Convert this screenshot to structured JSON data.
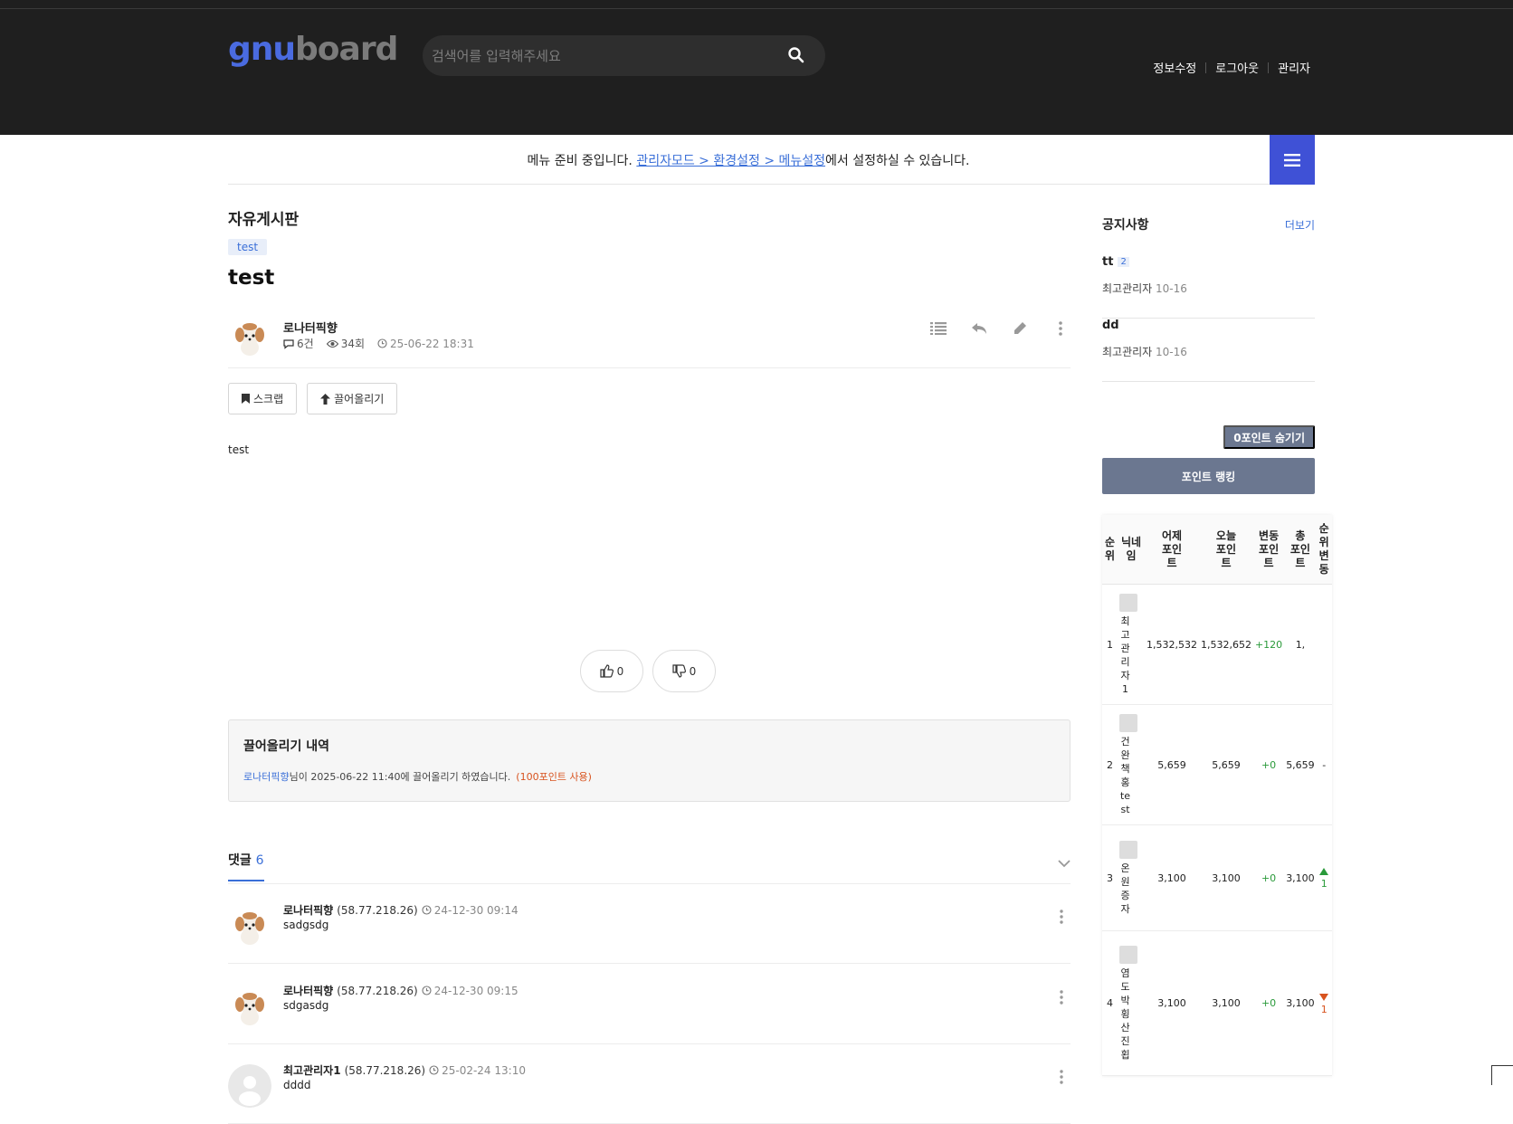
{
  "header": {
    "logo_part1": "gnu",
    "logo_part2": "board",
    "search_placeholder": "검색어를 입력해주세요",
    "nav": [
      "정보수정",
      "로그아웃",
      "관리자"
    ]
  },
  "menubar": {
    "msg_prefix": "메뉴 준비 중입니다. ",
    "link": "관리자모드 > 환경설정 > 메뉴설정",
    "msg_suffix": "에서 설정하실 수 있습니다."
  },
  "post": {
    "board_name": "자유게시판",
    "category": "test",
    "title": "test",
    "author": "로나터픽향",
    "comments_count": "6건",
    "views": "34회",
    "date": "25-06-22 18:31",
    "scrap_label": "스크랩",
    "bump_label": "끌어올리기",
    "content": "test",
    "like_count": "0",
    "dislike_count": "0"
  },
  "bump_history": {
    "title": "끌어올리기 내역",
    "user": "로나터픽향",
    "text": "님이 2025-06-22 11:40에 끌어올리기 하였습니다.",
    "points": "(100포인트 사용)"
  },
  "comments": {
    "label": "댓글",
    "count": "6",
    "items": [
      {
        "name": "로나터픽향",
        "ip": "(58.77.218.26)",
        "time": "24-12-30 09:14",
        "text": "sadgsdg"
      },
      {
        "name": "로나터픽향",
        "ip": "(58.77.218.26)",
        "time": "24-12-30 09:15",
        "text": "sdgasdg"
      },
      {
        "name": "최고관리자1",
        "ip": "(58.77.218.26)",
        "time": "25-02-24 13:10",
        "text": "dddd"
      }
    ]
  },
  "sidebar": {
    "notice_title": "공지사항",
    "notice_more": "더보기",
    "notices": [
      {
        "title": "tt",
        "count": "2",
        "author": "최고관리자",
        "date": "10-16"
      },
      {
        "title": "dd",
        "count": "",
        "author": "최고관리자",
        "date": "10-16"
      }
    ],
    "hide_zero_label": "0포인트 숨기기",
    "ranking_label": "포인트 랭킹",
    "table_headers": [
      "순위",
      "닉네임",
      "어제 포인트",
      "오늘 포인트",
      "변동 포인트",
      "총 포인트",
      "순위 변동"
    ],
    "rows": [
      {
        "rank": "1",
        "nick": "최고관리자1",
        "yesterday": "1,532,532",
        "today": "1,532,652",
        "change": "+120",
        "total": "1,",
        "rank_change": ""
      },
      {
        "rank": "2",
        "nick": "건완책홍test",
        "yesterday": "5,659",
        "today": "5,659",
        "change": "+0",
        "total": "5,659",
        "rank_change": "-"
      },
      {
        "rank": "3",
        "nick": "온원증자",
        "yesterday": "3,100",
        "today": "3,100",
        "change": "+0",
        "total": "3,100",
        "rank_change": "1"
      },
      {
        "rank": "4",
        "nick": "염도박횡산진횝",
        "yesterday": "3,100",
        "today": "3,100",
        "change": "+0",
        "total": "3,100",
        "rank_change": "1"
      }
    ]
  },
  "colors": {
    "header_bg": "#1f1f1f",
    "accent": "#3f51d6",
    "link": "#3a6fd8",
    "rank_button": "#6b7790"
  }
}
